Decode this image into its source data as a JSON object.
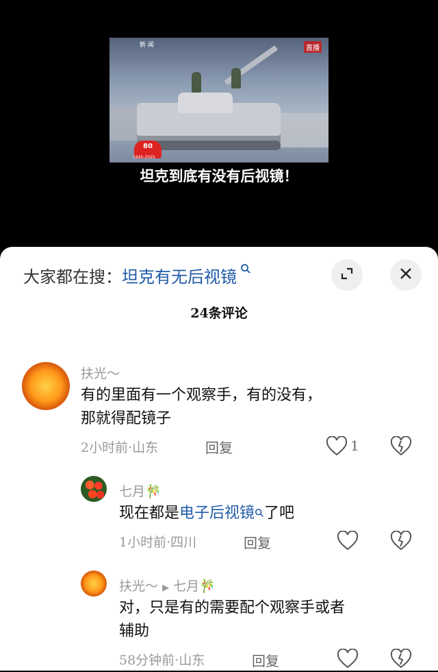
{
  "video": {
    "caption": "坦克到底有没有后视镜！",
    "channel": "新 闻",
    "live_badge": "直播",
    "anniversary": "80",
    "anniversary_years": "1945-2025"
  },
  "sheet": {
    "search_prefix": "大家都在搜：",
    "search_term": "坦克有无后视镜",
    "search_icon": "search-icon",
    "expand_icon": "expand-icon",
    "close_icon": "close-icon",
    "comment_count": "24条评论"
  },
  "comments": [
    {
      "user": "扶光～",
      "text_line1": "有的里面有一个观察手，有的没有，",
      "text_line2": "那就得配镜子",
      "time_location": "2小时前·山东",
      "reply_label": "回复",
      "likes": "1"
    },
    {
      "user": "七月🎋",
      "text_before": "现在都是",
      "text_link": "电子后视镜",
      "text_after": "了吧",
      "time_location": "1小时前·四川",
      "reply_label": "回复"
    },
    {
      "user": "扶光～",
      "reply_arrow": "▶",
      "reply_to": "七月🎋",
      "text_line1": "对，只是有的需要配个观察手或者",
      "text_line2": "辅助",
      "time_location": "58分钟前·山东",
      "reply_label": "回复"
    }
  ]
}
